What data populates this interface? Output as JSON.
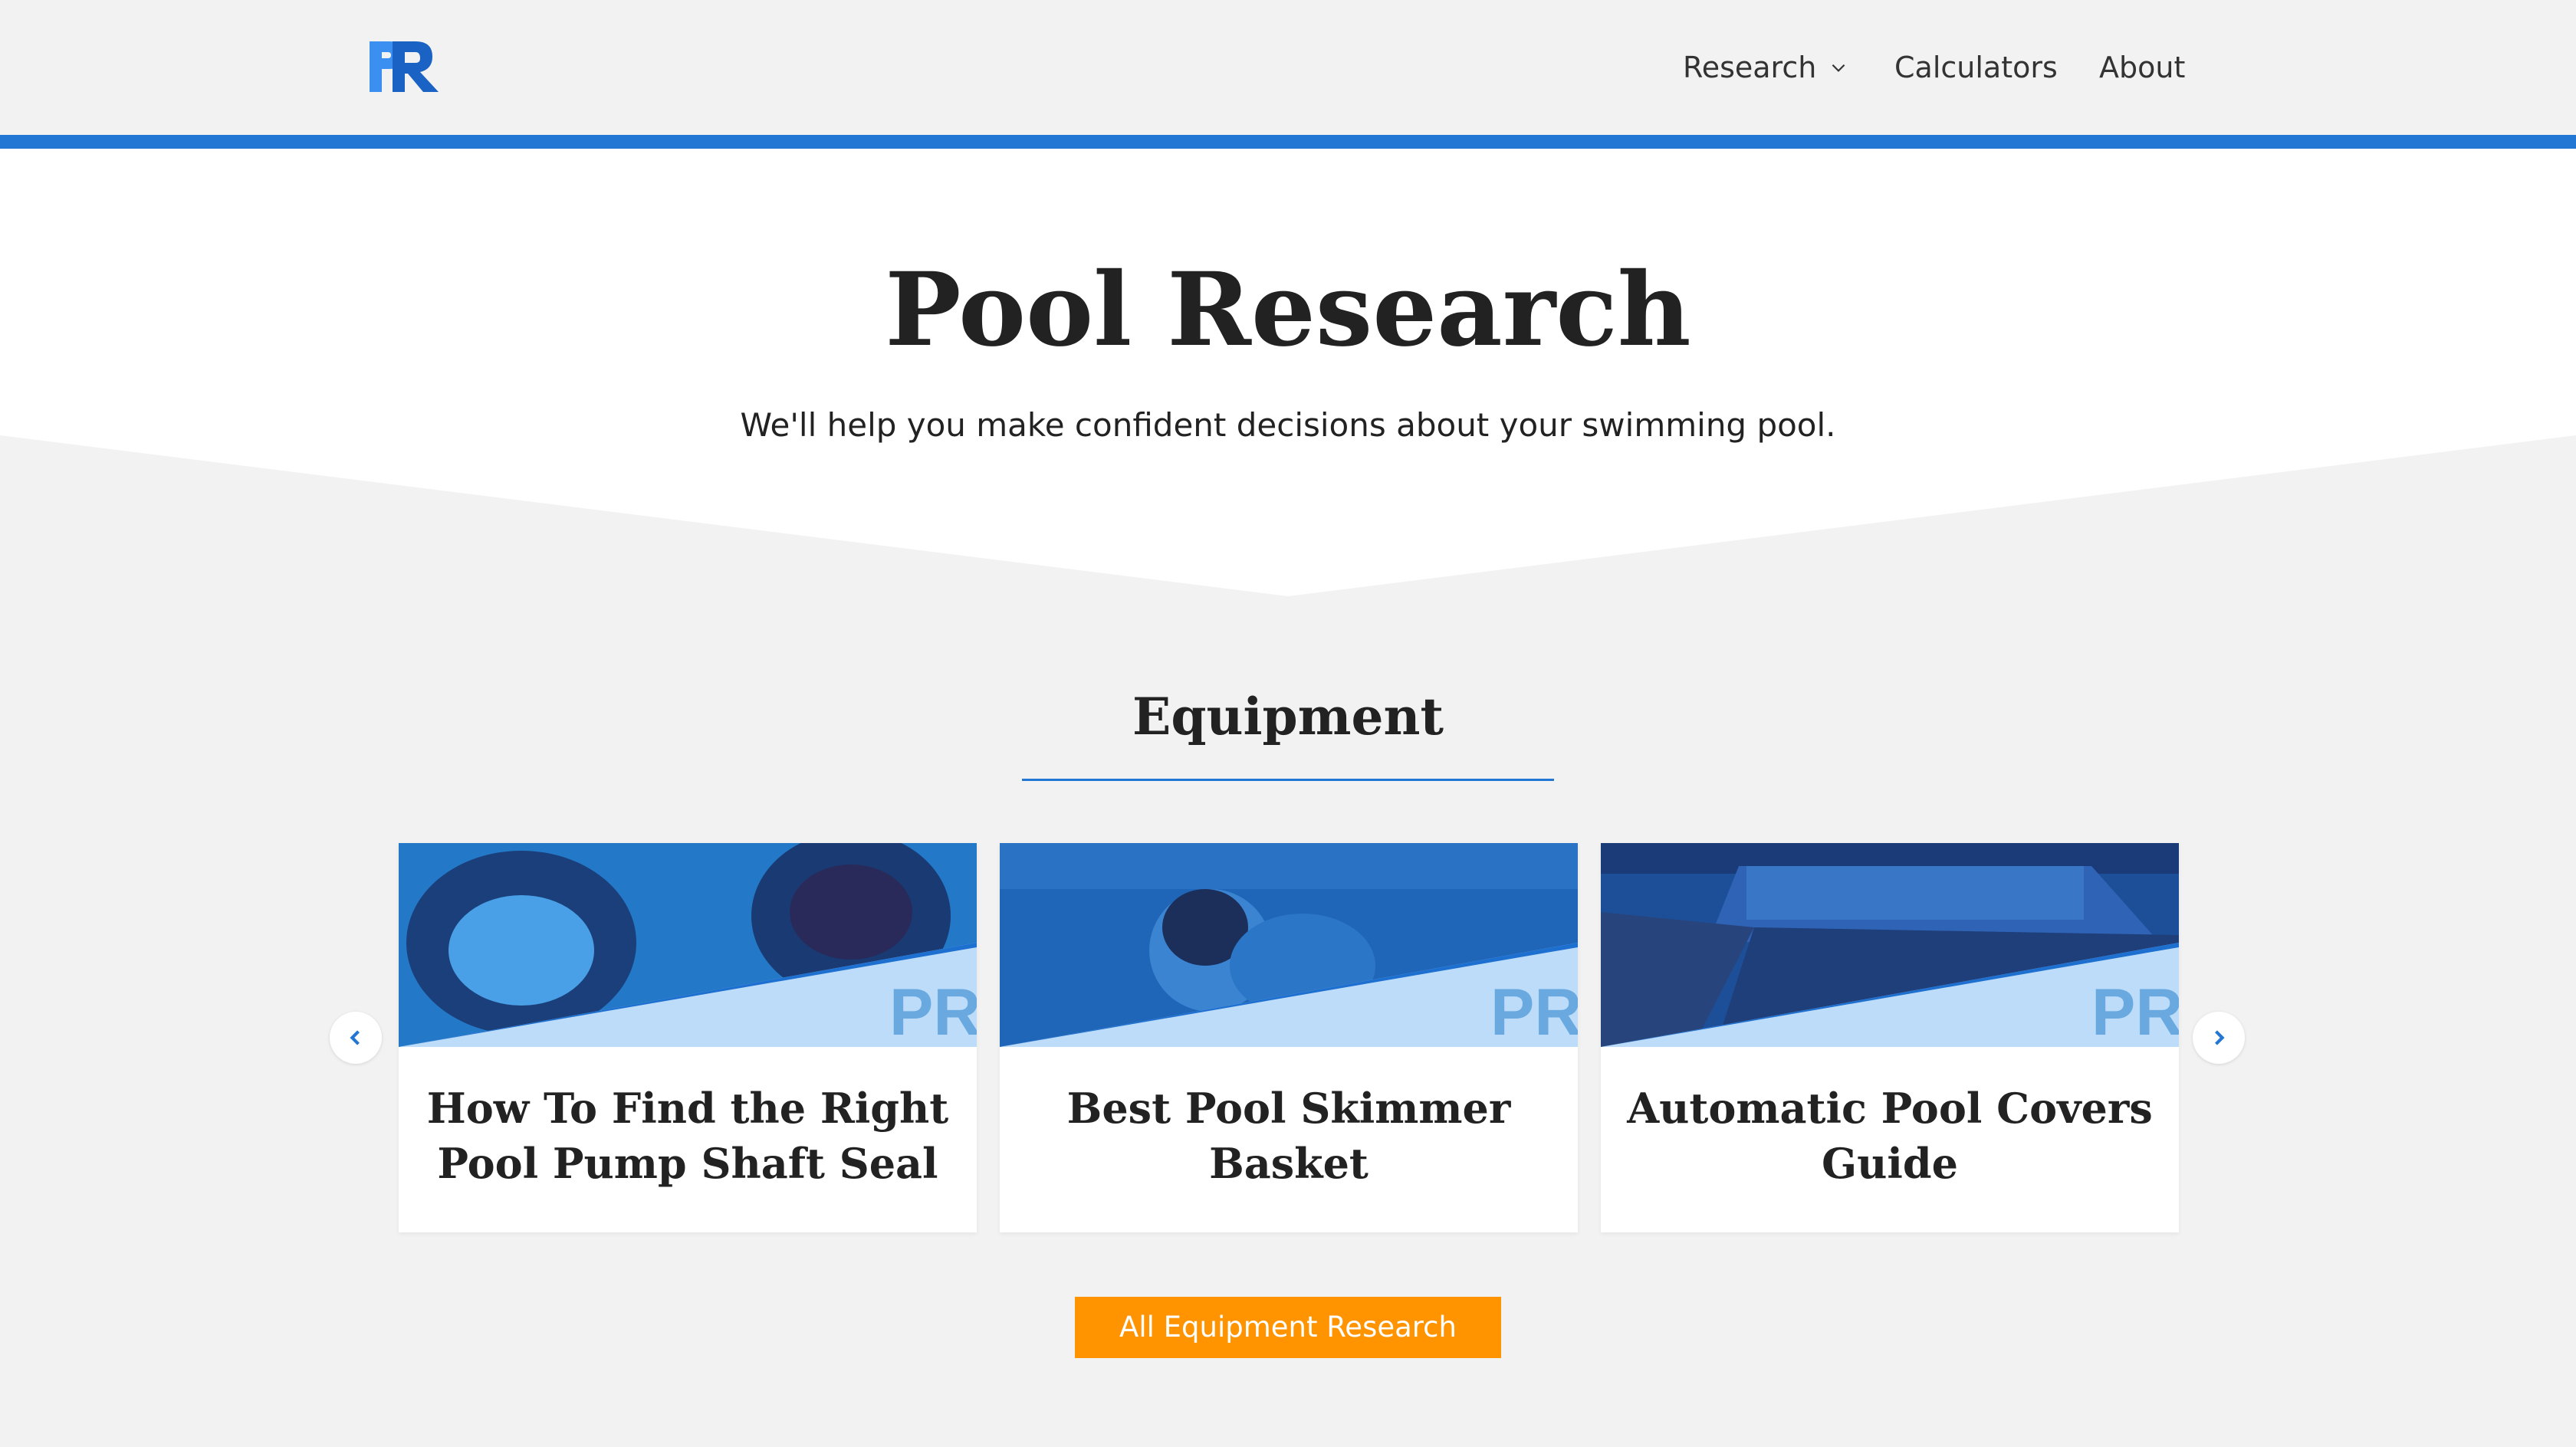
{
  "header": {
    "logo_alt": "PR",
    "nav": {
      "research": "Research",
      "calculators": "Calculators",
      "about": "About"
    }
  },
  "hero": {
    "title": "Pool Research",
    "subtitle": "We'll help you make confident decisions about your swimming pool."
  },
  "section": {
    "title": "Equipment",
    "cards": [
      {
        "title": "How To Find the Right Pool Pump Shaft Seal"
      },
      {
        "title": "Best Pool Skimmer Basket"
      },
      {
        "title": "Automatic Pool Covers Guide"
      }
    ],
    "cta_label": "All Equipment Research"
  },
  "colors": {
    "accent_blue": "#2277d4",
    "cta_orange": "#ff9400",
    "background": "#f2f2f2"
  },
  "icons": {
    "carousel_prev": "chevron-left-icon",
    "carousel_next": "chevron-right-icon",
    "dropdown": "chevron-down-icon"
  }
}
